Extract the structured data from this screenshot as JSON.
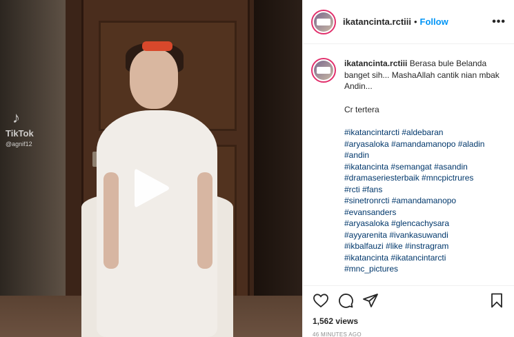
{
  "video": {
    "watermark_logo": "TikTok",
    "watermark_user": "@agnif12",
    "play_icon": "play-icon"
  },
  "header": {
    "username": "ikatancinta.rctiii",
    "separator": "•",
    "follow_label": "Follow",
    "more_icon": "more-options-icon",
    "more_label": "•••"
  },
  "caption": {
    "username": "ikatancinta.rctiii",
    "text": "Berasa bule Belanda banget sih... MashaAllah cantik nian mbak Andin...",
    "credit": "Cr tertera",
    "hashtag_lines": [
      "#ikatancintarcti #aldebaran",
      "#aryasaloka #amandamanopo #aladin",
      "#andin",
      "#ikatancinta #semangat #asandin",
      "#dramaseriesterbaik #mncpictrures",
      "#rcti #fans",
      "#sinetronrcti #amandamanopo",
      "#evansanders",
      "#aryasaloka #glencachysara",
      "#ayyarenita #ivankasuwandi",
      "#ikbalfauzi #like #instragram",
      "#ikatancinta #ikatancintarcti",
      "#mnc_pictures"
    ]
  },
  "actions": {
    "like_icon": "heart-icon",
    "comment_icon": "comment-icon",
    "share_icon": "share-icon",
    "save_icon": "bookmark-icon",
    "views": "1,562 views",
    "timestamp": "46 MINUTES AGO"
  },
  "colors": {
    "link_blue": "#0095f6",
    "hashtag": "#00376b",
    "muted": "#8e8e8e"
  }
}
